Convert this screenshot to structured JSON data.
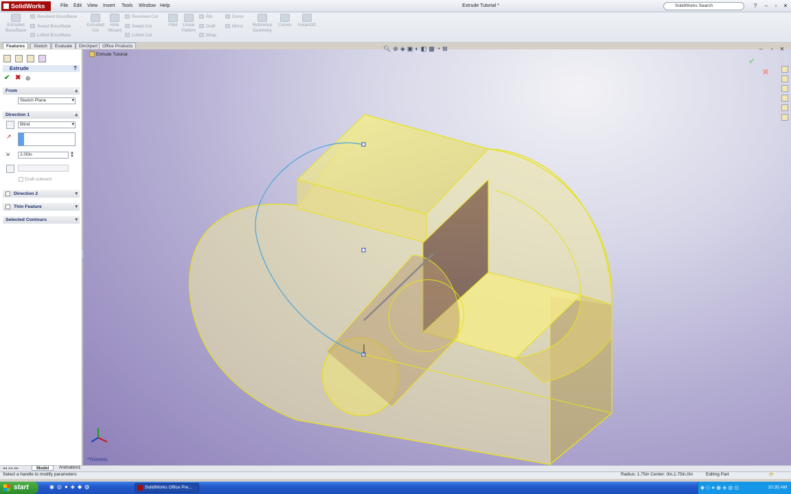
{
  "app": {
    "name": "SolidWorks",
    "document_title": "Extrude Tutorial *",
    "menu": [
      "File",
      "Edit",
      "View",
      "Insert",
      "Tools",
      "Window",
      "Help"
    ],
    "search_placeholder": "SolidWorks Search"
  },
  "ribbon": {
    "buttons": [
      {
        "label": "Extruded\nBoss/Base"
      },
      {
        "label": "Extruded\nCut"
      },
      {
        "label": "Hole\nWizard"
      },
      {
        "label": "Fillet"
      },
      {
        "label": "Linear\nPattern"
      },
      {
        "label": "Reference\nGeometry"
      },
      {
        "label": "Curves"
      },
      {
        "label": "Instant3D"
      }
    ],
    "small_buttons": [
      {
        "label": "Revolved Boss/Base"
      },
      {
        "label": "Swept Boss/Base"
      },
      {
        "label": "Lofted Boss/Base"
      },
      {
        "label": "Revolved Cut"
      },
      {
        "label": "Swept Cut"
      },
      {
        "label": "Lofted Cut"
      },
      {
        "label": "Rib"
      },
      {
        "label": "Draft"
      },
      {
        "label": "Wrap"
      },
      {
        "label": "Dome"
      },
      {
        "label": "Mirror"
      }
    ]
  },
  "tabs": [
    "Features",
    "Sketch",
    "Evaluate",
    "DimXpert",
    "Office Products"
  ],
  "property_manager": {
    "title": "Extrude",
    "help": "?",
    "from_label": "From",
    "from_value": "Sketch Plane",
    "direction1_label": "Direction 1",
    "direction1_type": "Blind",
    "depth_value": "2.00in",
    "draft_label": "Draft outward",
    "direction2_label": "Direction 2",
    "thin_feature_label": "Thin Feature",
    "selected_contours_label": "Selected Contours"
  },
  "viewport": {
    "tree_label": "Extrude Tutorial",
    "view_name": "*Trimetric"
  },
  "bottom_tabs": [
    "Model",
    "Animation1"
  ],
  "status": {
    "message": "Select a handle to modify parameters",
    "measure": "Radius: 1.75in  Center: 0in,1.75in,0in",
    "mode": "Editing Part"
  },
  "taskbar": {
    "start_label": "start",
    "task_label": "SolidWorks Office Pre...",
    "clock": "10:35 AM"
  },
  "colors": {
    "part_fill": "#ece48a",
    "part_edge": "#e6e21a",
    "sketch_line": "#4aa3d8",
    "brand_red": "#a40b0b"
  }
}
